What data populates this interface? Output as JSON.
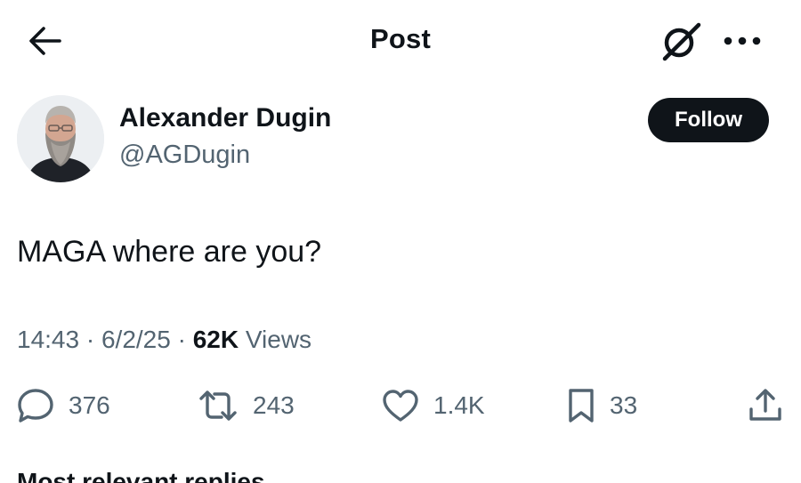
{
  "header": {
    "title": "Post",
    "back_icon": "arrow-left-icon",
    "grok_icon": "grok-icon",
    "more_icon": "more-horizontal-icon"
  },
  "author": {
    "name": "Alexander Dugin",
    "handle": "@AGDugin",
    "follow_label": "Follow"
  },
  "post": {
    "text": "MAGA where are you?",
    "time": "14:43",
    "separator": "·",
    "date": "6/2/25",
    "views_count": "62K",
    "views_label": "Views"
  },
  "actions": {
    "replies": "376",
    "reposts": "243",
    "likes": "1.4K",
    "bookmarks": "33"
  },
  "replies_sort": {
    "label": "Most relevant replies"
  },
  "colors": {
    "text_primary": "#0f1419",
    "text_secondary": "#536471",
    "follow_bg": "#0f1419"
  }
}
